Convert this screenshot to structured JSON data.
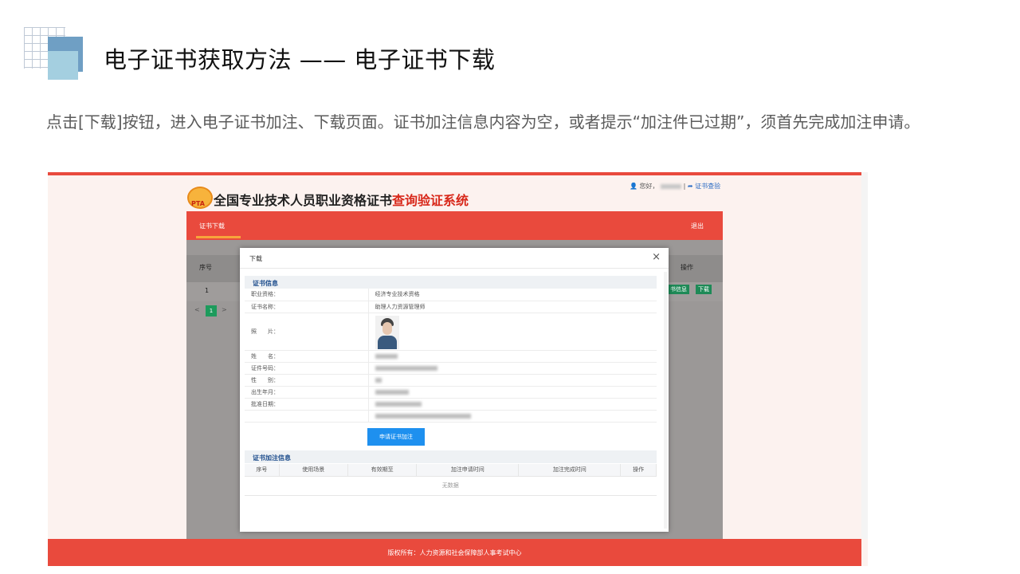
{
  "slide": {
    "title": "电子证书获取方法 —— 电子证书下载",
    "description": "点击[下载]按钮，进入电子证书加注、下载页面。证书加注信息内容为空，或者提示“加注件已过期”，须首先完成加注申请。"
  },
  "site": {
    "logo_text": "PTA",
    "title_black": "全国专业技术人员职业资格证书",
    "title_red": "查询验证系统",
    "greeting": "您好，",
    "separator": "|",
    "verify_link": "证书查验",
    "nav_tab": "证书下载",
    "logout": "退出",
    "table_headers": {
      "index": "序号",
      "action": "操作"
    },
    "row_index": "1",
    "row_buttons": [
      "书信息",
      "下载"
    ],
    "pager": {
      "prev": "<",
      "current": "1",
      "next": ">"
    },
    "footer": "版权所有：人力资源和社会保障部人事考试中心"
  },
  "modal": {
    "title": "下载",
    "close": "×",
    "section_info": "证书信息",
    "fields": [
      {
        "key": "职业资格：",
        "value": "经济专业技术资格"
      },
      {
        "key": "证书名称：",
        "value": "助理人力资源管理师"
      },
      {
        "key": "照　　片：",
        "value": ""
      },
      {
        "key": "姓　　名：",
        "value": ""
      },
      {
        "key": "证件号码：",
        "value": ""
      },
      {
        "key": "性　　别：",
        "value": ""
      },
      {
        "key": "出生年月：",
        "value": ""
      },
      {
        "key": "批准日期：",
        "value": ""
      },
      {
        "key": "",
        "value": ""
      }
    ],
    "apply_button": "申请证书加注",
    "section_addendum": "证书加注信息",
    "addendum_headers": [
      "序号",
      "使用场景",
      "有效期至",
      "加注申请时间",
      "加注完成时间",
      "操作"
    ],
    "empty_text": "无数据"
  }
}
